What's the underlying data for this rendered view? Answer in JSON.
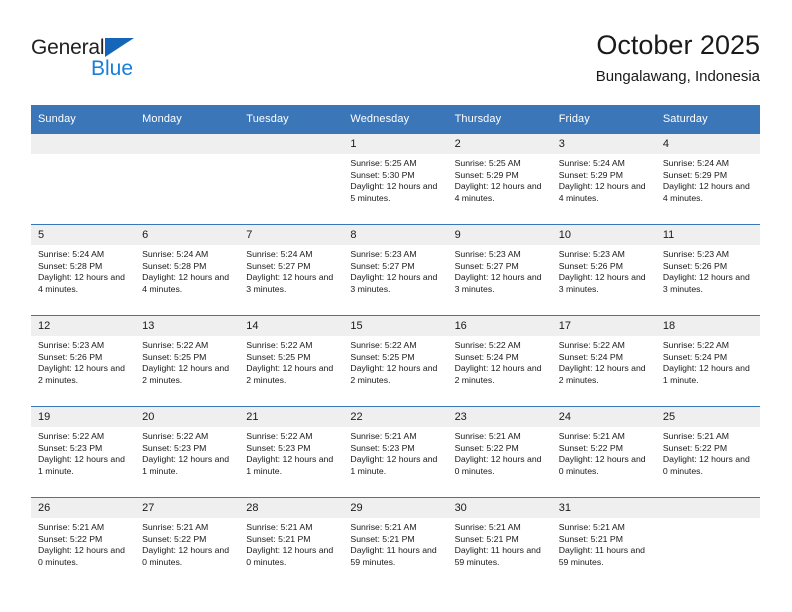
{
  "brand": {
    "name_primary": "General",
    "name_secondary": "Blue",
    "triangle_icon": "triangle-icon",
    "colors": {
      "primary_text": "#231f20",
      "secondary_text": "#1a7ed6",
      "triangle": "#1565b8"
    }
  },
  "header": {
    "title": "October 2025",
    "subtitle": "Bungalawang, Indonesia"
  },
  "theme": {
    "header_blue": "#3a76b8",
    "daynum_gray": "#efefef",
    "cell_text": "#1a1a1a"
  },
  "weekday_headers": [
    "Sunday",
    "Monday",
    "Tuesday",
    "Wednesday",
    "Thursday",
    "Friday",
    "Saturday"
  ],
  "weeks": [
    [
      {
        "day": "",
        "empty": true,
        "sunrise": "",
        "sunset": "",
        "daylight": ""
      },
      {
        "day": "",
        "empty": true,
        "sunrise": "",
        "sunset": "",
        "daylight": ""
      },
      {
        "day": "",
        "empty": true,
        "sunrise": "",
        "sunset": "",
        "daylight": ""
      },
      {
        "day": "1",
        "empty": false,
        "sunrise": "Sunrise: 5:25 AM",
        "sunset": "Sunset: 5:30 PM",
        "daylight": "Daylight: 12 hours and 5 minutes."
      },
      {
        "day": "2",
        "empty": false,
        "sunrise": "Sunrise: 5:25 AM",
        "sunset": "Sunset: 5:29 PM",
        "daylight": "Daylight: 12 hours and 4 minutes."
      },
      {
        "day": "3",
        "empty": false,
        "sunrise": "Sunrise: 5:24 AM",
        "sunset": "Sunset: 5:29 PM",
        "daylight": "Daylight: 12 hours and 4 minutes."
      },
      {
        "day": "4",
        "empty": false,
        "sunrise": "Sunrise: 5:24 AM",
        "sunset": "Sunset: 5:29 PM",
        "daylight": "Daylight: 12 hours and 4 minutes."
      }
    ],
    [
      {
        "day": "5",
        "empty": false,
        "sunrise": "Sunrise: 5:24 AM",
        "sunset": "Sunset: 5:28 PM",
        "daylight": "Daylight: 12 hours and 4 minutes."
      },
      {
        "day": "6",
        "empty": false,
        "sunrise": "Sunrise: 5:24 AM",
        "sunset": "Sunset: 5:28 PM",
        "daylight": "Daylight: 12 hours and 4 minutes."
      },
      {
        "day": "7",
        "empty": false,
        "sunrise": "Sunrise: 5:24 AM",
        "sunset": "Sunset: 5:27 PM",
        "daylight": "Daylight: 12 hours and 3 minutes."
      },
      {
        "day": "8",
        "empty": false,
        "sunrise": "Sunrise: 5:23 AM",
        "sunset": "Sunset: 5:27 PM",
        "daylight": "Daylight: 12 hours and 3 minutes."
      },
      {
        "day": "9",
        "empty": false,
        "sunrise": "Sunrise: 5:23 AM",
        "sunset": "Sunset: 5:27 PM",
        "daylight": "Daylight: 12 hours and 3 minutes."
      },
      {
        "day": "10",
        "empty": false,
        "sunrise": "Sunrise: 5:23 AM",
        "sunset": "Sunset: 5:26 PM",
        "daylight": "Daylight: 12 hours and 3 minutes."
      },
      {
        "day": "11",
        "empty": false,
        "sunrise": "Sunrise: 5:23 AM",
        "sunset": "Sunset: 5:26 PM",
        "daylight": "Daylight: 12 hours and 3 minutes."
      }
    ],
    [
      {
        "day": "12",
        "empty": false,
        "sunrise": "Sunrise: 5:23 AM",
        "sunset": "Sunset: 5:26 PM",
        "daylight": "Daylight: 12 hours and 2 minutes."
      },
      {
        "day": "13",
        "empty": false,
        "sunrise": "Sunrise: 5:22 AM",
        "sunset": "Sunset: 5:25 PM",
        "daylight": "Daylight: 12 hours and 2 minutes."
      },
      {
        "day": "14",
        "empty": false,
        "sunrise": "Sunrise: 5:22 AM",
        "sunset": "Sunset: 5:25 PM",
        "daylight": "Daylight: 12 hours and 2 minutes."
      },
      {
        "day": "15",
        "empty": false,
        "sunrise": "Sunrise: 5:22 AM",
        "sunset": "Sunset: 5:25 PM",
        "daylight": "Daylight: 12 hours and 2 minutes."
      },
      {
        "day": "16",
        "empty": false,
        "sunrise": "Sunrise: 5:22 AM",
        "sunset": "Sunset: 5:24 PM",
        "daylight": "Daylight: 12 hours and 2 minutes."
      },
      {
        "day": "17",
        "empty": false,
        "sunrise": "Sunrise: 5:22 AM",
        "sunset": "Sunset: 5:24 PM",
        "daylight": "Daylight: 12 hours and 2 minutes."
      },
      {
        "day": "18",
        "empty": false,
        "sunrise": "Sunrise: 5:22 AM",
        "sunset": "Sunset: 5:24 PM",
        "daylight": "Daylight: 12 hours and 1 minute."
      }
    ],
    [
      {
        "day": "19",
        "empty": false,
        "sunrise": "Sunrise: 5:22 AM",
        "sunset": "Sunset: 5:23 PM",
        "daylight": "Daylight: 12 hours and 1 minute."
      },
      {
        "day": "20",
        "empty": false,
        "sunrise": "Sunrise: 5:22 AM",
        "sunset": "Sunset: 5:23 PM",
        "daylight": "Daylight: 12 hours and 1 minute."
      },
      {
        "day": "21",
        "empty": false,
        "sunrise": "Sunrise: 5:22 AM",
        "sunset": "Sunset: 5:23 PM",
        "daylight": "Daylight: 12 hours and 1 minute."
      },
      {
        "day": "22",
        "empty": false,
        "sunrise": "Sunrise: 5:21 AM",
        "sunset": "Sunset: 5:23 PM",
        "daylight": "Daylight: 12 hours and 1 minute."
      },
      {
        "day": "23",
        "empty": false,
        "sunrise": "Sunrise: 5:21 AM",
        "sunset": "Sunset: 5:22 PM",
        "daylight": "Daylight: 12 hours and 0 minutes."
      },
      {
        "day": "24",
        "empty": false,
        "sunrise": "Sunrise: 5:21 AM",
        "sunset": "Sunset: 5:22 PM",
        "daylight": "Daylight: 12 hours and 0 minutes."
      },
      {
        "day": "25",
        "empty": false,
        "sunrise": "Sunrise: 5:21 AM",
        "sunset": "Sunset: 5:22 PM",
        "daylight": "Daylight: 12 hours and 0 minutes."
      }
    ],
    [
      {
        "day": "26",
        "empty": false,
        "sunrise": "Sunrise: 5:21 AM",
        "sunset": "Sunset: 5:22 PM",
        "daylight": "Daylight: 12 hours and 0 minutes."
      },
      {
        "day": "27",
        "empty": false,
        "sunrise": "Sunrise: 5:21 AM",
        "sunset": "Sunset: 5:22 PM",
        "daylight": "Daylight: 12 hours and 0 minutes."
      },
      {
        "day": "28",
        "empty": false,
        "sunrise": "Sunrise: 5:21 AM",
        "sunset": "Sunset: 5:21 PM",
        "daylight": "Daylight: 12 hours and 0 minutes."
      },
      {
        "day": "29",
        "empty": false,
        "sunrise": "Sunrise: 5:21 AM",
        "sunset": "Sunset: 5:21 PM",
        "daylight": "Daylight: 11 hours and 59 minutes."
      },
      {
        "day": "30",
        "empty": false,
        "sunrise": "Sunrise: 5:21 AM",
        "sunset": "Sunset: 5:21 PM",
        "daylight": "Daylight: 11 hours and 59 minutes."
      },
      {
        "day": "31",
        "empty": false,
        "sunrise": "Sunrise: 5:21 AM",
        "sunset": "Sunset: 5:21 PM",
        "daylight": "Daylight: 11 hours and 59 minutes."
      },
      {
        "day": "",
        "empty": true,
        "sunrise": "",
        "sunset": "",
        "daylight": ""
      }
    ]
  ]
}
